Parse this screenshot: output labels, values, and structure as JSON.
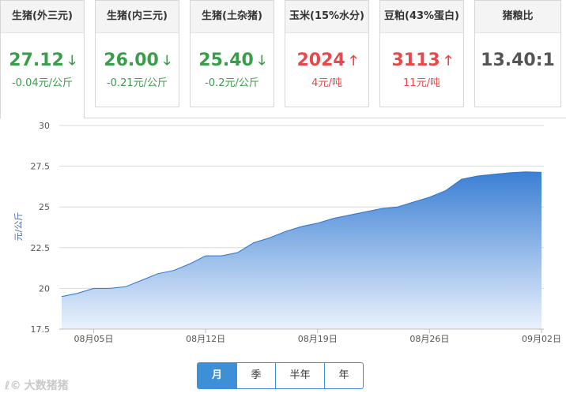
{
  "cards": [
    {
      "title": "生猪(外三元)",
      "value": "27.12",
      "direction": "down",
      "change": "-0.04元/公斤"
    },
    {
      "title": "生猪(内三元)",
      "value": "26.00",
      "direction": "down",
      "change": "-0.21元/公斤"
    },
    {
      "title": "生猪(土杂猪)",
      "value": "25.40",
      "direction": "down",
      "change": "-0.2元/公斤"
    },
    {
      "title": "玉米(15%水分)",
      "value": "2024",
      "direction": "up",
      "change": "4元/吨"
    },
    {
      "title": "豆粕(43%蛋白)",
      "value": "3113",
      "direction": "up",
      "change": "11元/吨"
    },
    {
      "title": "猪粮比",
      "value": "13.40:1",
      "direction": "none",
      "change": ""
    }
  ],
  "arrows": {
    "down": "🡓",
    "up": "🡑"
  },
  "colors": {
    "down": "#3a9d4a",
    "up": "#e8474b",
    "accent": "#3d8fd6",
    "area_top": "#3b7fd4",
    "area_bottom": "#eaf2fc"
  },
  "chart_data": {
    "type": "area",
    "ylabel": "元/公斤",
    "ylim": [
      17.5,
      30
    ],
    "yticks": [
      "30",
      "27.5",
      "25",
      "22.5",
      "20",
      "17.5"
    ],
    "xticks": [
      "08月05日",
      "08月12日",
      "08月19日",
      "08月26日",
      "09月02日"
    ],
    "x": [
      "08-03",
      "08-04",
      "08-05",
      "08-06",
      "08-07",
      "08-08",
      "08-09",
      "08-10",
      "08-11",
      "08-12",
      "08-13",
      "08-14",
      "08-15",
      "08-16",
      "08-17",
      "08-18",
      "08-19",
      "08-20",
      "08-21",
      "08-22",
      "08-23",
      "08-24",
      "08-25",
      "08-26",
      "08-27",
      "08-28",
      "08-29",
      "08-30",
      "08-31",
      "09-01",
      "09-02"
    ],
    "values": [
      19.5,
      19.7,
      20.0,
      20.0,
      20.1,
      20.5,
      20.9,
      21.1,
      21.5,
      22.0,
      22.0,
      22.2,
      22.8,
      23.1,
      23.5,
      23.8,
      24.0,
      24.3,
      24.5,
      24.7,
      24.9,
      25.0,
      25.3,
      25.6,
      26.0,
      26.7,
      26.9,
      27.0,
      27.1,
      27.15,
      27.12
    ],
    "grid": true
  },
  "tabs": [
    {
      "label": "月",
      "active": true
    },
    {
      "label": "季",
      "active": false
    },
    {
      "label": "半年",
      "active": false
    },
    {
      "label": "年",
      "active": false
    }
  ],
  "watermark": "大数猪猪"
}
